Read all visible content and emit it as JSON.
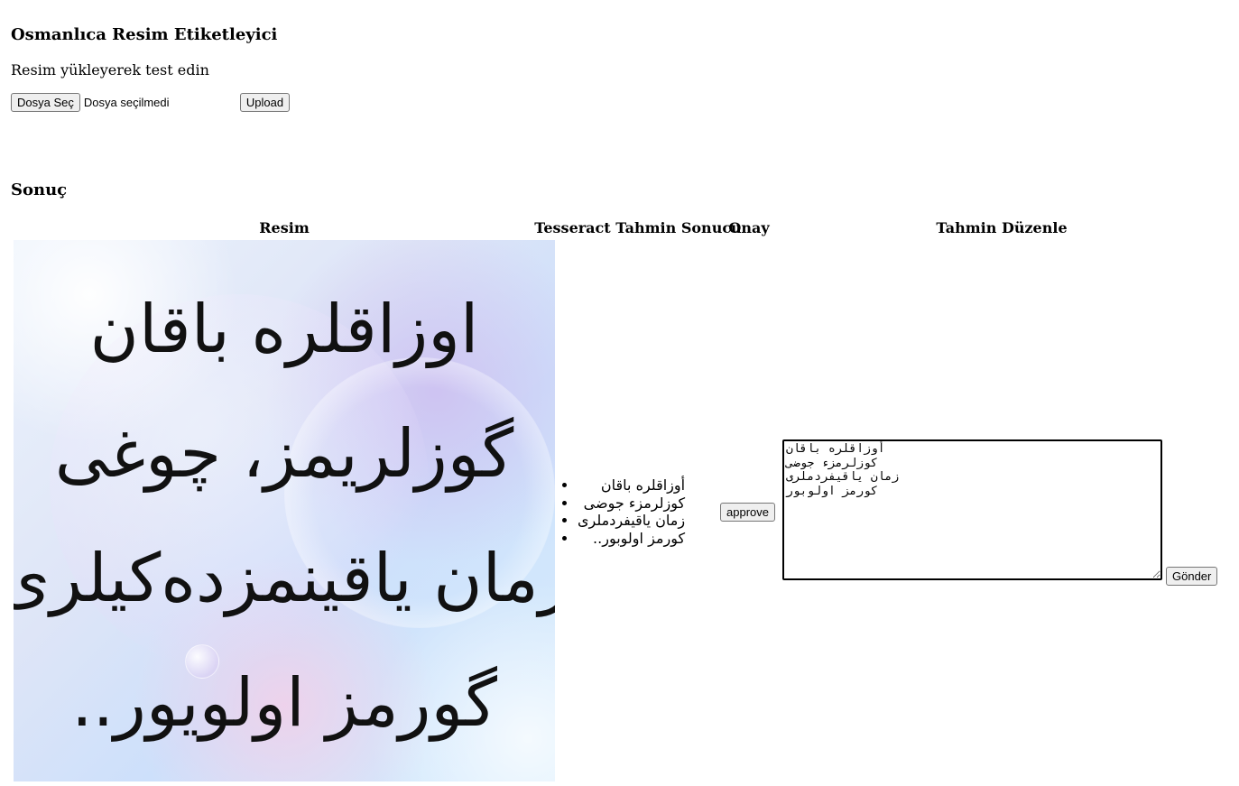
{
  "header": {
    "title": "Osmanlıca Resim Etiketleyici",
    "subtitle": "Resim yükleyerek test edin"
  },
  "upload": {
    "choose_label": "Dosya Seç",
    "status": "Dosya seçilmedi",
    "upload_label": "Upload"
  },
  "result": {
    "title": "Sonuç",
    "columns": [
      "Resim",
      "Tesseract Tahmin Sonucu",
      "Onay",
      "Tahmin Düzenle"
    ],
    "image_lines": [
      "اوزاقلره باقان",
      "گوزلريمز، چوغى",
      "زمان ياقينمزدەكيلرى",
      "گورمز اولويور.."
    ],
    "tesseract_lines": [
      "أوزاقلره باقان",
      "كوزلرمزء جوضى",
      "زمان ياقيفردملرى",
      "كورمز اولوبور.."
    ],
    "approve_label": "approve",
    "edit_value": "أوزاقلره باقان\nكوزلرمزء جوضى\nزمان ياقيفردملرى\nكورمز اولوبور",
    "send_label": "Gönder"
  }
}
